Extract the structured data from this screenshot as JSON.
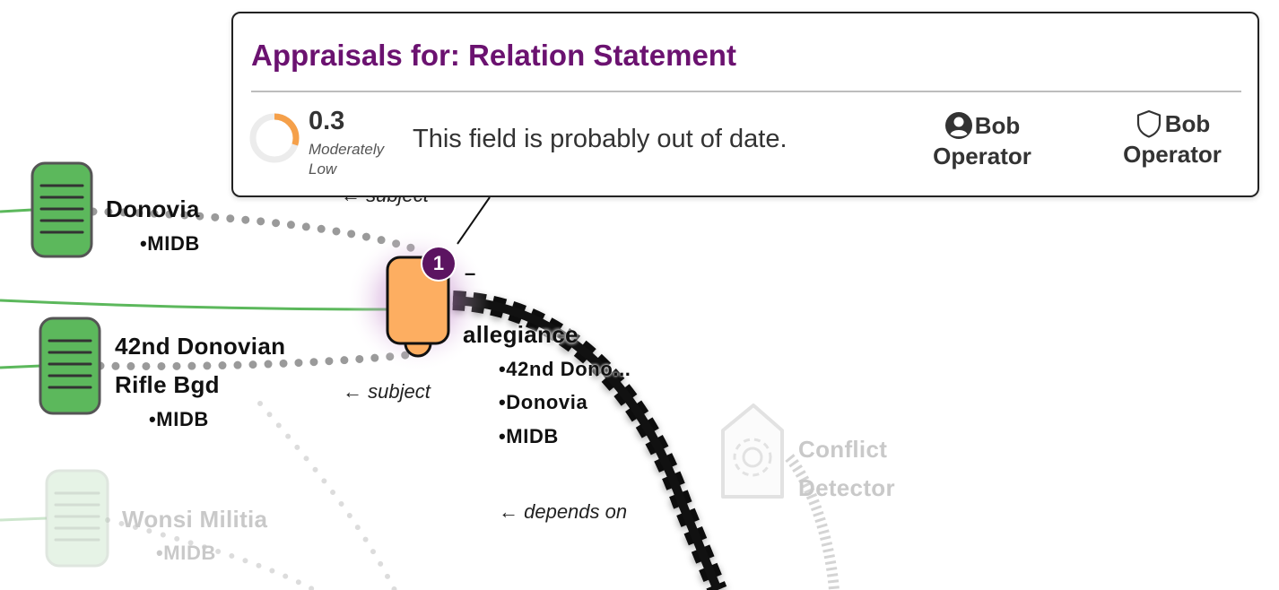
{
  "graph": {
    "nodes": {
      "donovia": {
        "name": "Donovia",
        "source": "•MIDB"
      },
      "brigade": {
        "name_line1": "42nd Donovian",
        "name_line2": "Rifle Bgd",
        "source": "•MIDB"
      },
      "wonsi": {
        "name": "Wonsi Militia",
        "source": "•MIDB"
      },
      "relation": {
        "name": "allegiance",
        "details": [
          "•42nd Dono...",
          "•Donovia",
          "•MIDB"
        ],
        "badge_count": "1",
        "collapse_symbol": "–"
      },
      "conflict_detector": {
        "name_line1": "Conflict",
        "name_line2": "Detector"
      }
    },
    "edges": {
      "subject_top": "← subject",
      "subject_bottom": "← subject",
      "depends_on": "← depends on"
    },
    "colors": {
      "entity_green": "#5cb85c",
      "relation_orange": "#fdae61",
      "badge_purple": "#5c1461",
      "halo_purple": "#b36bbf"
    }
  },
  "popup": {
    "title": "Appraisals for: Relation Statement",
    "score": {
      "value": "0.3",
      "label": "Moderately Low",
      "fraction": 0.3,
      "color": "#f5a04a"
    },
    "text": "This field is probably out of date.",
    "authors": [
      {
        "icon": "user-circle-icon",
        "name_line1": "Bob",
        "name_line2": "Operator"
      },
      {
        "icon": "shield-icon",
        "name_line1": "Bob",
        "name_line2": "Operator"
      }
    ]
  }
}
